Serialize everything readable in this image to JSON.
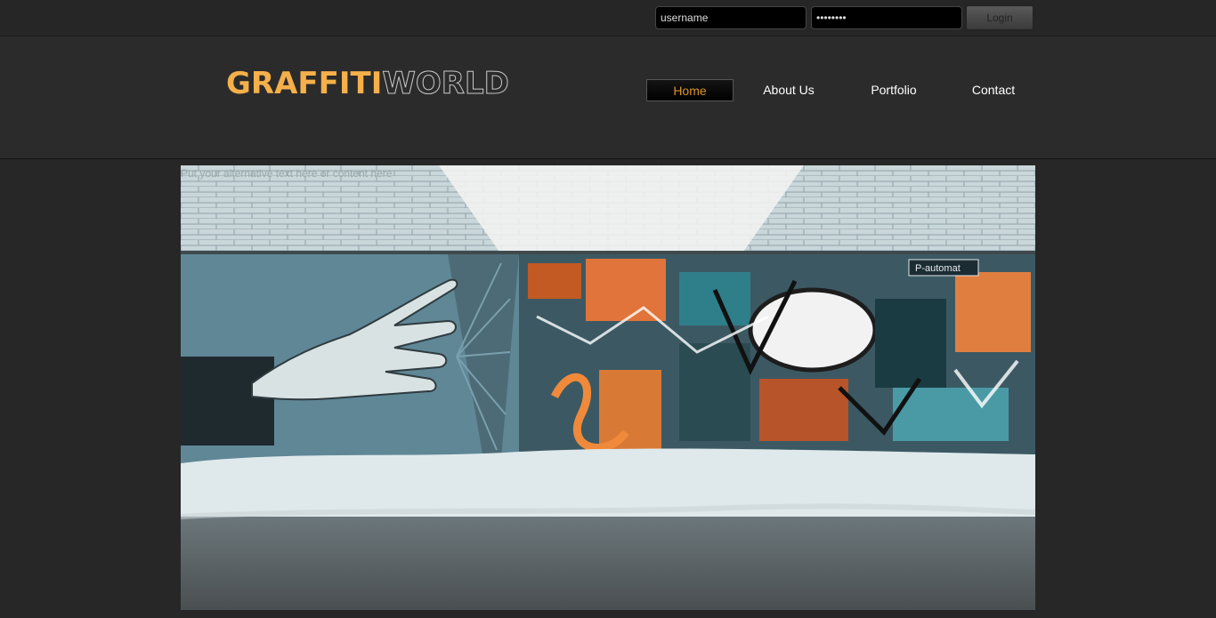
{
  "login": {
    "username_value": "username",
    "password_value": "••••••••",
    "login_label": "Login"
  },
  "logo": {
    "part1": "GRAFFITI",
    "part2": "WORLD"
  },
  "nav": {
    "items": [
      {
        "label": "Home"
      },
      {
        "label": "About Us"
      },
      {
        "label": "Portfolio"
      },
      {
        "label": "Contact"
      }
    ]
  },
  "hero": {
    "alt_text": "Put your alternative text here or content here",
    "sign_text": "P-automat"
  },
  "colors": {
    "accent": "#f5b04a",
    "background": "#272727"
  }
}
